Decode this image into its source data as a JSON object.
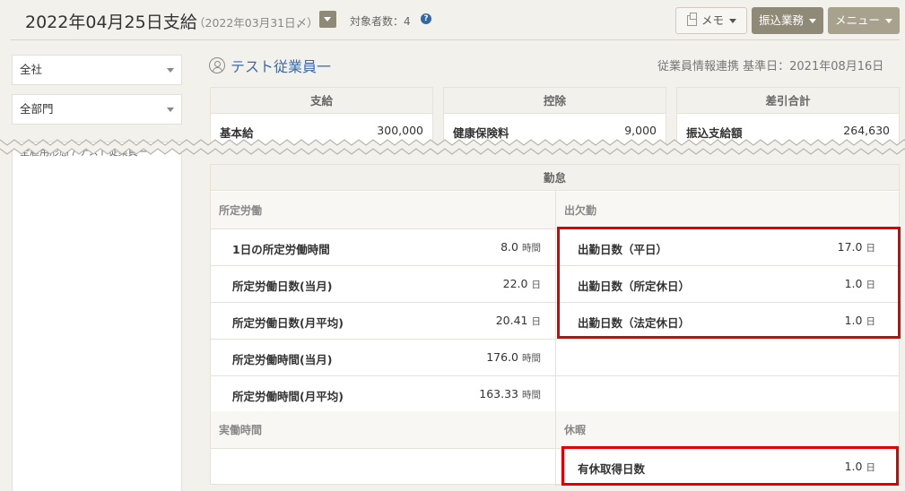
{
  "header": {
    "title": "2022年04月25日支給",
    "close_date": "（2022年03月31日〆）",
    "target_count": "対象者数：4",
    "help": "?",
    "memo_label": "メモ",
    "transfer_label": "振込業務",
    "menu_label": "メニュー"
  },
  "sidebar": {
    "company_select": "全社",
    "department_select": "全部門",
    "list_partial_text": "全雇用形態 / テスト従業員一"
  },
  "employee": {
    "name": "テスト従業員一",
    "sync_info": "従業員情報連携 基準日：2021年08月16日"
  },
  "summary": {
    "pay": {
      "title": "支給",
      "label": "基本給",
      "value": "300,000"
    },
    "deduction": {
      "title": "控除",
      "label": "健康保険料",
      "value": "9,000"
    },
    "net": {
      "title": "差引合計",
      "label": "振込支給額",
      "value": "264,630"
    }
  },
  "attendance": {
    "title": "勤怠",
    "scheduled": {
      "title": "所定労働",
      "rows": [
        {
          "label": "1日の所定労働時間",
          "value": "8.0",
          "unit": "時間"
        },
        {
          "label": "所定労働日数(当月)",
          "value": "22.0",
          "unit": "日"
        },
        {
          "label": "所定労働日数(月平均)",
          "value": "20.41",
          "unit": "日"
        },
        {
          "label": "所定労働時間(当月)",
          "value": "176.0",
          "unit": "時間"
        },
        {
          "label": "所定労働時間(月平均)",
          "value": "163.33",
          "unit": "時間"
        }
      ]
    },
    "presence": {
      "title": "出欠勤",
      "rows": [
        {
          "label": "出勤日数（平日）",
          "value": "17.0",
          "unit": "日"
        },
        {
          "label": "出勤日数（所定休日）",
          "value": "1.0",
          "unit": "日"
        },
        {
          "label": "出勤日数（法定休日）",
          "value": "1.0",
          "unit": "日"
        }
      ]
    },
    "actual": {
      "title": "実働時間"
    },
    "leave": {
      "title": "休暇",
      "rows": [
        {
          "label": "有休取得日数",
          "value": "1.0",
          "unit": "日"
        }
      ]
    }
  },
  "colors": {
    "accent": "#8f8a78",
    "highlight": "#e00000",
    "link": "#3c6aa8"
  }
}
